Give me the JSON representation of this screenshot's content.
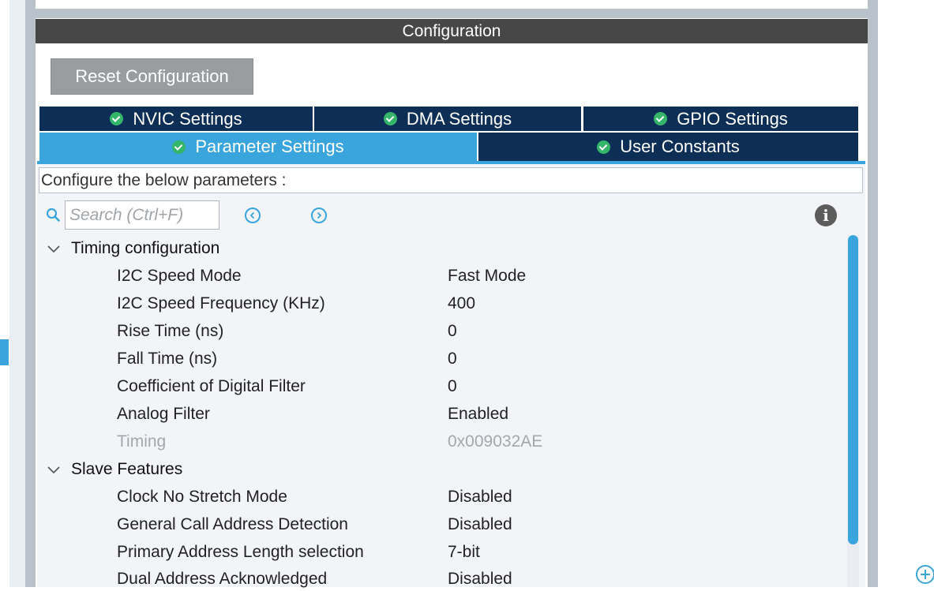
{
  "header": {
    "title": "Configuration"
  },
  "toolbar": {
    "reset_label": "Reset Configuration"
  },
  "tabs": {
    "nvic": "NVIC Settings",
    "dma": "DMA Settings",
    "gpio": "GPIO Settings",
    "parameter": "Parameter Settings",
    "user_constants": "User Constants",
    "active": "Parameter Settings"
  },
  "content": {
    "description": "Configure the below parameters :",
    "search_placeholder": "Search (Ctrl+F)"
  },
  "groups": [
    {
      "title": "Timing configuration",
      "params": [
        {
          "name": "I2C Speed Mode",
          "value": "Fast Mode"
        },
        {
          "name": "I2C Speed Frequency (KHz)",
          "value": "400"
        },
        {
          "name": "Rise Time (ns)",
          "value": "0"
        },
        {
          "name": "Fall Time (ns)",
          "value": "0"
        },
        {
          "name": "Coefficient of Digital Filter",
          "value": "0"
        },
        {
          "name": "Analog Filter",
          "value": "Enabled"
        },
        {
          "name": "Timing",
          "value": "0x009032AE"
        }
      ]
    },
    {
      "title": "Slave Features",
      "params": [
        {
          "name": "Clock No Stretch Mode",
          "value": "Disabled"
        },
        {
          "name": "General Call Address Detection",
          "value": "Disabled"
        },
        {
          "name": "Primary Address Length selection",
          "value": "7-bit"
        },
        {
          "name": "Dual Address Acknowledged",
          "value": "Disabled"
        }
      ]
    }
  ],
  "colors": {
    "accent": "#3aa5dc",
    "tab_dark": "#0d2f55",
    "header_bg": "#474747",
    "check_green": "#34b56a"
  }
}
